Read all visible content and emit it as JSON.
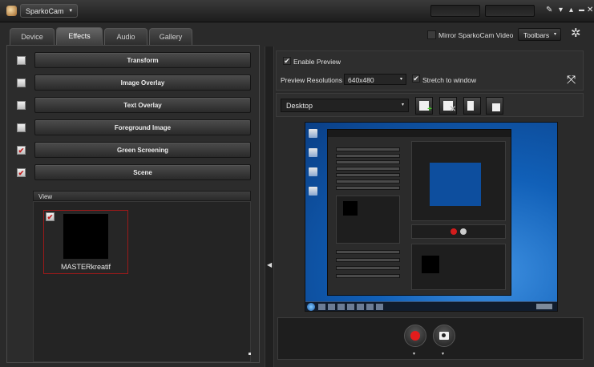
{
  "app": {
    "menu_label": "SparkoCam",
    "menu_caret": "▾",
    "window_icons": {
      "tools": "✎",
      "dropdown": "▾",
      "up": "▴",
      "minimize": "▬",
      "close": "✕"
    }
  },
  "tabs": [
    {
      "label": "Device",
      "active": false
    },
    {
      "label": "Effects",
      "active": true
    },
    {
      "label": "Audio",
      "active": false
    },
    {
      "label": "Gallery",
      "active": false
    }
  ],
  "effects": [
    {
      "label": "Transform",
      "checked": false
    },
    {
      "label": "Image Overlay",
      "checked": false
    },
    {
      "label": "Text Overlay",
      "checked": false
    },
    {
      "label": "Foreground Image",
      "checked": false
    },
    {
      "label": "Green Screening",
      "checked": true
    },
    {
      "label": "Scene",
      "checked": true
    }
  ],
  "check_mark": "✔",
  "view": {
    "header": "View",
    "scene_label": "MASTERkreatif",
    "scene_checked": true
  },
  "topbar": {
    "mirror_label": "Mirror SparkoCam Video",
    "mirror_checked": false,
    "toolbars_label": "Toolbars",
    "toolbars_caret": "▾",
    "gear_glyph": "✲"
  },
  "preview": {
    "enable_label": "Enable Preview",
    "enable_checked": true,
    "resolution_label": "Preview Resolutions",
    "resolution_value": "640x480",
    "stretch_label": "Stretch to window",
    "stretch_checked": true,
    "fullscreen_glyph": "⤧"
  },
  "source": {
    "value": "Desktop",
    "caret": "▾",
    "add_badge": "+",
    "remove_badge": "✕"
  },
  "divider_arrow": "◀",
  "record": {
    "caret": "▾"
  },
  "colors": {
    "accent_red": "#e21c1c",
    "checkmark_red": "#c42020",
    "desktop_blue": "#1160b8"
  }
}
